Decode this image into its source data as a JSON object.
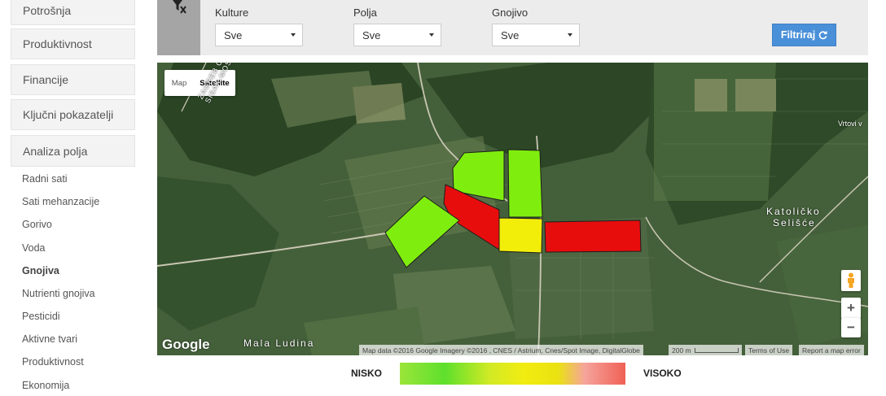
{
  "sidebar": {
    "sections": [
      {
        "label": "Potrošnja"
      },
      {
        "label": "Produktivnost"
      },
      {
        "label": "Financije"
      },
      {
        "label": "Ključni pokazatelji"
      },
      {
        "label": "Analiza polja"
      }
    ],
    "sub_items": [
      {
        "label": "Radni sati"
      },
      {
        "label": "Sati mehanzacije"
      },
      {
        "label": "Gorivo"
      },
      {
        "label": "Voda"
      },
      {
        "label": "Gnojiva",
        "active": true
      },
      {
        "label": "Nutrienti gnojiva"
      },
      {
        "label": "Pesticidi"
      },
      {
        "label": "Aktivne tvari"
      },
      {
        "label": "Produktivnost"
      },
      {
        "label": "Ekonomija"
      }
    ]
  },
  "filters": {
    "icon": "filter-clear-icon",
    "kulture": {
      "label": "Kulture",
      "value": "Sve"
    },
    "polja": {
      "label": "Polja",
      "value": "Sve"
    },
    "gnojivo": {
      "label": "Gnojivo",
      "value": "Sve"
    },
    "button_label": "Filtriraj",
    "button_icon": "refresh-icon",
    "button_color": "#4a90d9"
  },
  "map": {
    "type_map": "Map",
    "type_satellite": "Satellite",
    "road_label_1": "ZAGREB COUNTY",
    "road_label_2": "SISAK-MOSLAVINA COU...",
    "place_mala_ludina": "Mala Ludina",
    "place_katolicko_1": "Katoličko",
    "place_katolicko_2": "Selišće",
    "place_vrtovi": "Vrtovi v",
    "google_logo": "Google",
    "attribution": "Map data ©2016 Google Imagery ©2016 , CNES / Astrium, Cnes/Spot Image, DigitalGlobe",
    "scale": "200 m",
    "terms": "Terms of Use",
    "report": "Report a map error",
    "zoom_in": "+",
    "zoom_out": "−",
    "fields": [
      {
        "id": "field-1",
        "color": "#7fee0e"
      },
      {
        "id": "field-2",
        "color": "#7fee0e"
      },
      {
        "id": "field-3",
        "color": "#e80d0d"
      },
      {
        "id": "field-4",
        "color": "#7fee0e"
      },
      {
        "id": "field-5",
        "color": "#f2ee0a"
      },
      {
        "id": "field-6",
        "color": "#e80d0d"
      }
    ]
  },
  "legend": {
    "low": "NISKO",
    "high": "VISOKO"
  }
}
